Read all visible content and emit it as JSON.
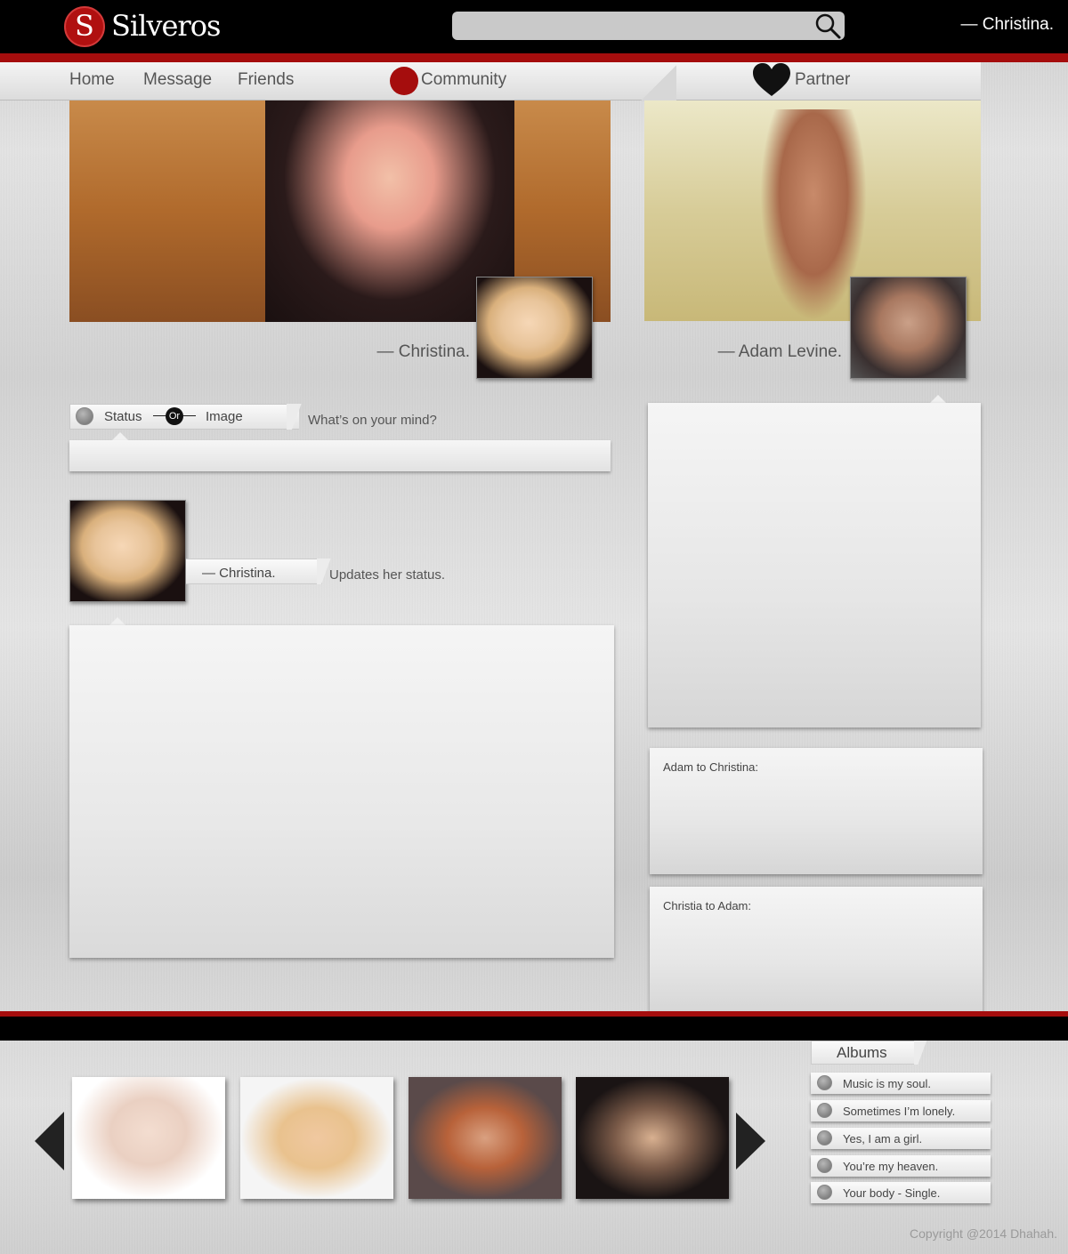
{
  "header": {
    "logo_letter": "S",
    "logo_text": "Silveros",
    "search_placeholder": "",
    "user_name": "— Christina."
  },
  "nav": {
    "items": [
      "Home",
      "Message",
      "Friends"
    ],
    "community_label": "Community",
    "partner_label": "Partner"
  },
  "profile": {
    "owner_caption": "— Christina.",
    "partner_caption": "— Adam Levine."
  },
  "composer": {
    "tab_status": "Status",
    "or_label": "Or",
    "tab_image": "Image",
    "prompt": "What’s on your mind?"
  },
  "post": {
    "author": "— Christina.",
    "action": "Updates her status."
  },
  "messages": {
    "adam_to_christina": "Adam to Christina:",
    "christina_to_adam": "Christia to Adam:"
  },
  "albums": {
    "title": "Albums",
    "items": [
      "Music is my soul.",
      "Sometimes I’m lonely.",
      "Yes, I am a girl.",
      "You’re my heaven.",
      "Your body - Single."
    ]
  },
  "footer": {
    "copyright": "Copyright @2014 Dhahah."
  },
  "colors": {
    "accent_red": "#a50d0d",
    "topbar": "#000000"
  }
}
